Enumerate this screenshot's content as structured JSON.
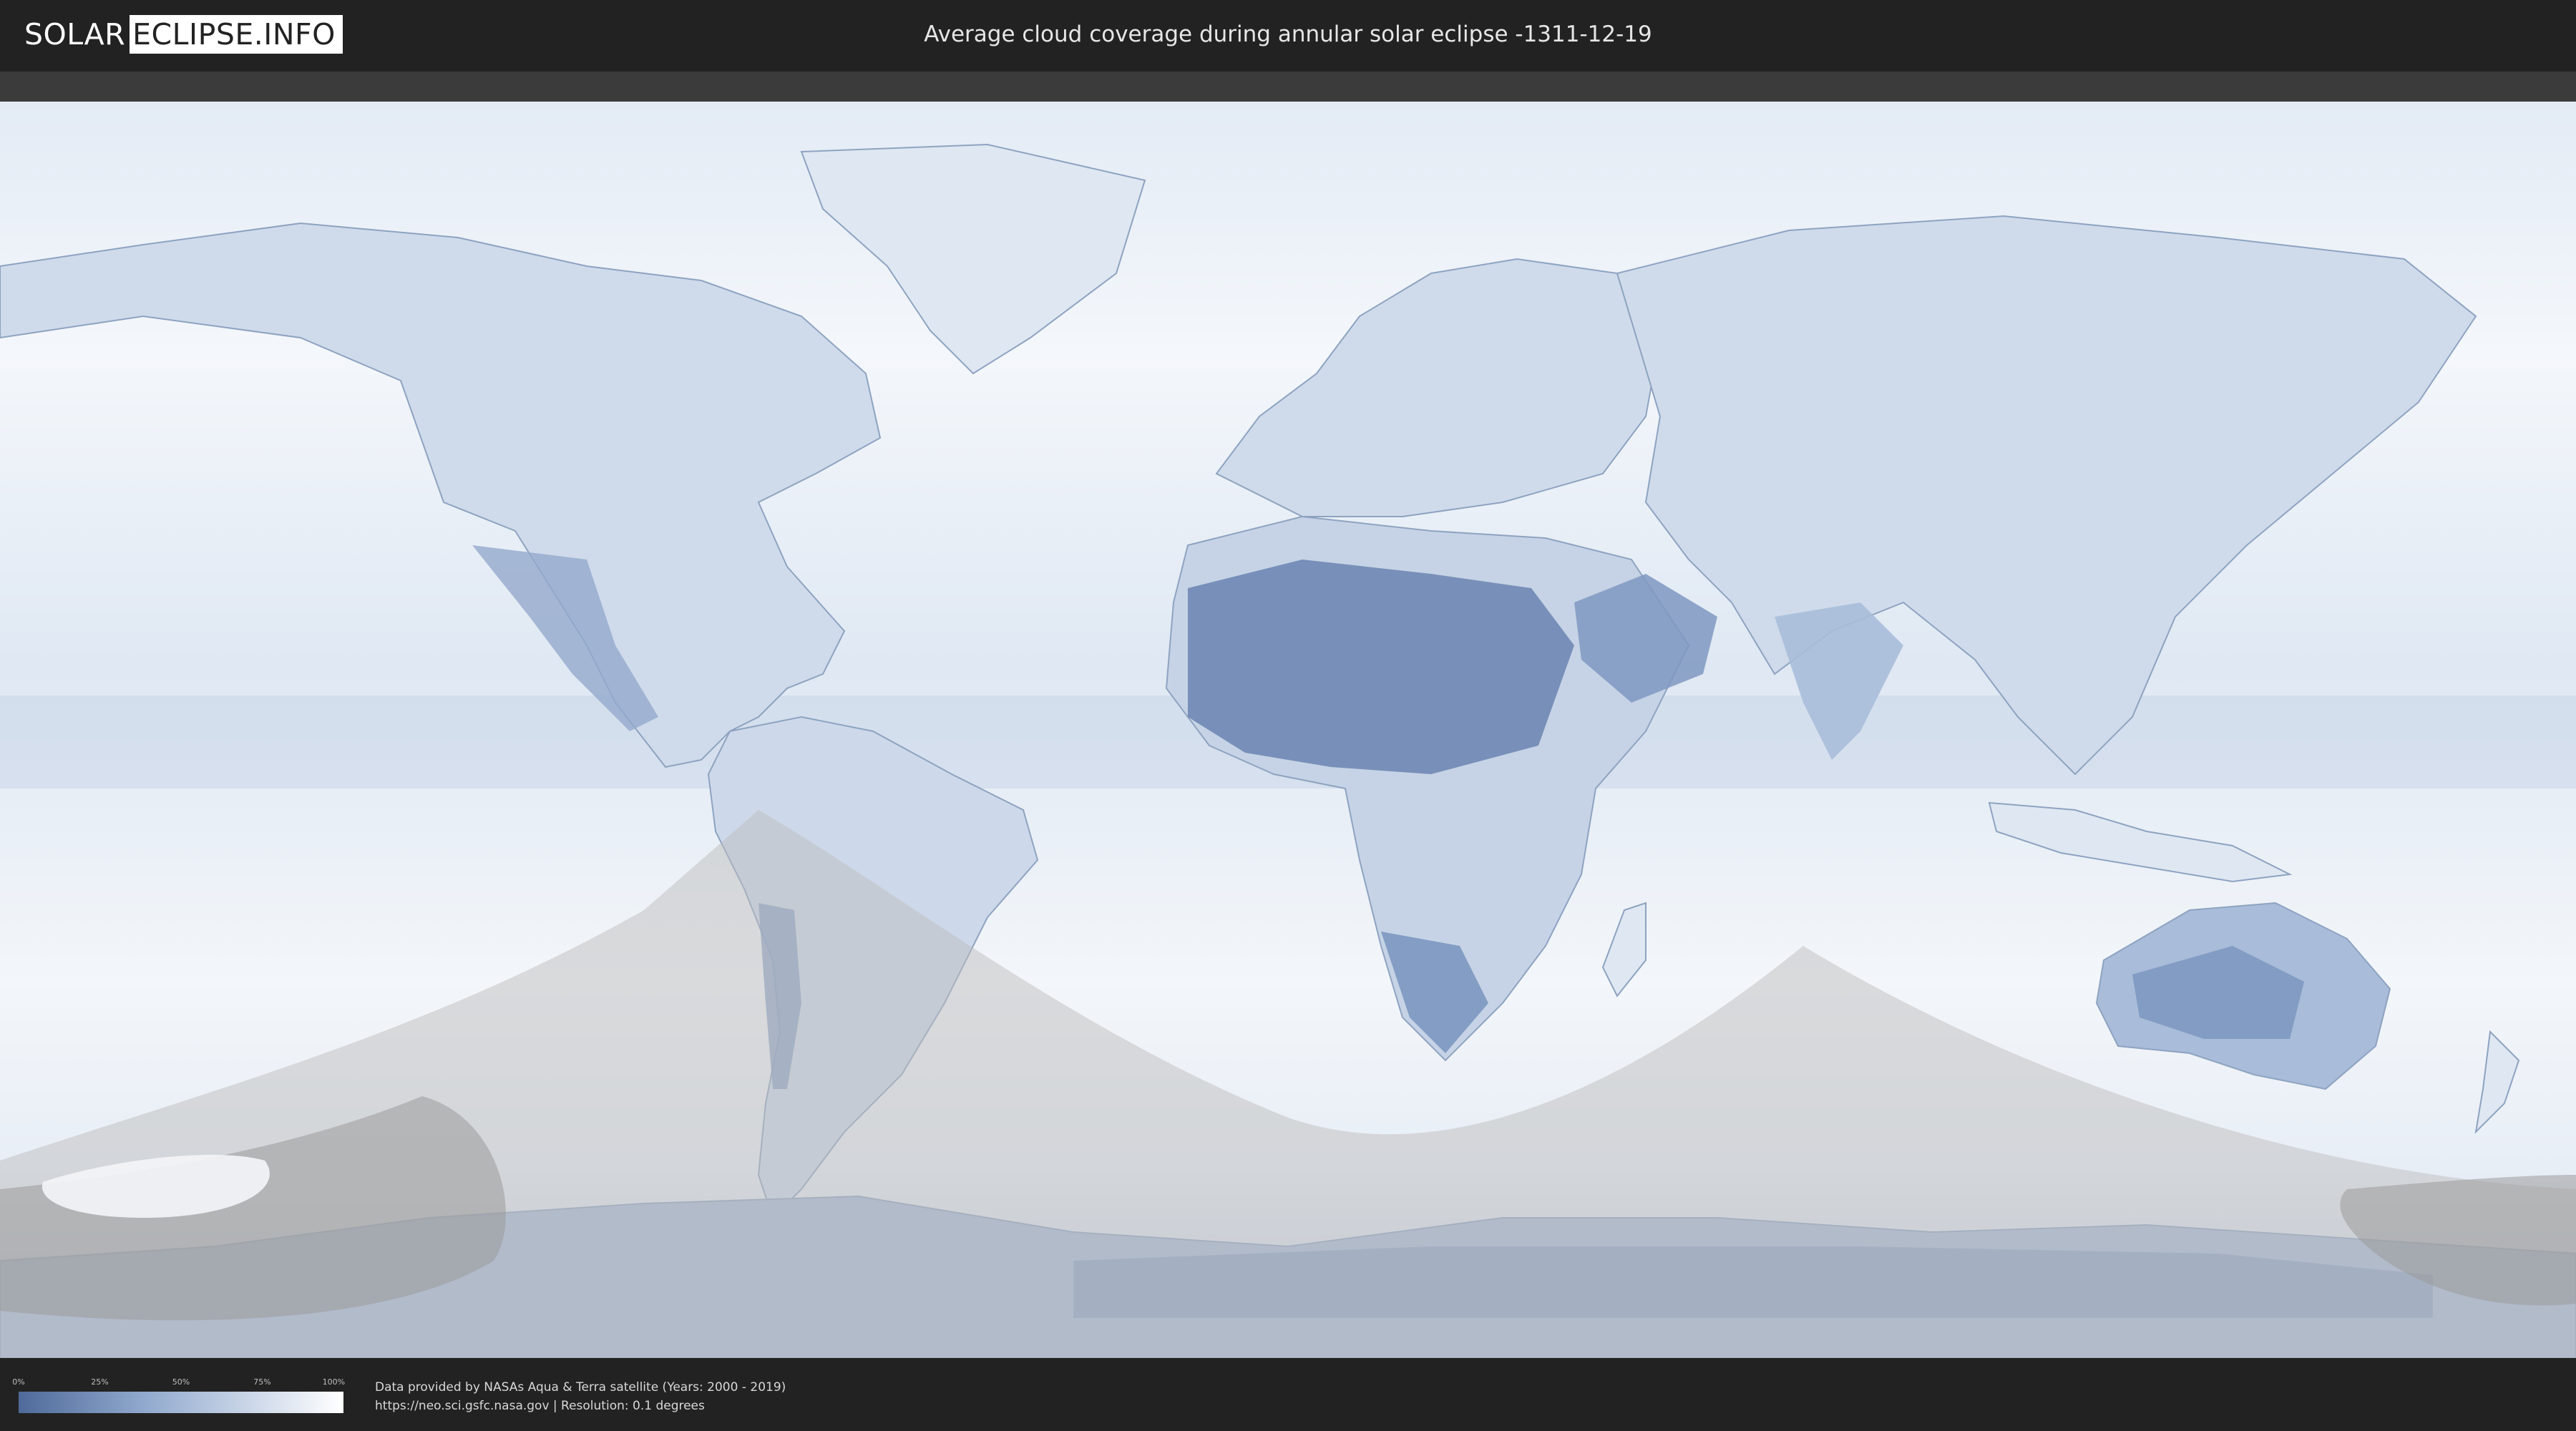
{
  "header": {
    "logo_part1": "SOLAR",
    "logo_part2": "ECLIPSE.INFO",
    "title": "Average cloud coverage during annular solar eclipse -1311-12-19"
  },
  "legend": {
    "ticks": [
      "0%",
      "25%",
      "50%",
      "75%",
      "100%"
    ],
    "values": [
      0,
      25,
      50,
      75,
      100
    ],
    "colors": {
      "low": "#4f6a9a",
      "mid": "#93abcf",
      "high": "#ffffff"
    }
  },
  "footer": {
    "credit_line1": "Data provided by NASAs Aqua & Terra satellite (Years: 2000 - 2019)",
    "credit_line2": "https://neo.sci.gsfc.nasa.gov | Resolution: 0.1 degrees"
  },
  "map": {
    "projection": "equirectangular",
    "colors": {
      "ocean_cloud": "#eef3f9",
      "land_clear": "#6a84b0",
      "eclipse_zone": "#cfcfcf",
      "annular_path": "#9a9a9a"
    }
  }
}
